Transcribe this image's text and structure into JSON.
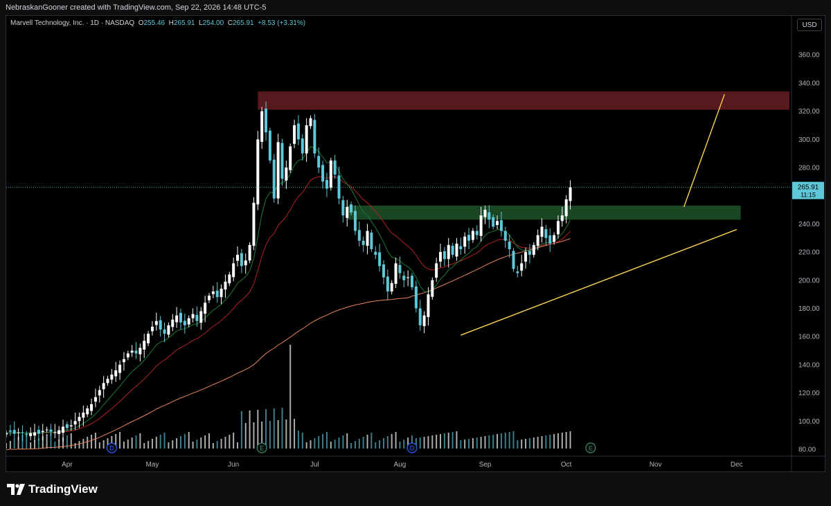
{
  "header": {
    "credit": "NebraskanGooner created with TradingView.com, Sep 22, 2026 14:48 UTC-5"
  },
  "legend": {
    "symbol": "Marvell Technology, Inc. · 1D · NASDAQ",
    "o_label": "O",
    "o": "255.46",
    "h_label": "H",
    "h": "265.91",
    "l_label": "L",
    "l": "254.00",
    "c_label": "C",
    "c": "265.91",
    "change": "+8.53 (+3.31%)"
  },
  "currency": "USD",
  "price_label": {
    "value": "265.91",
    "countdown": "11:15"
  },
  "brand": {
    "name": "TradingView"
  },
  "colors": {
    "up": "#ffffff",
    "down": "#5ec8d8",
    "ema_fast": "#1e7a32",
    "ema_mid": "#b22222",
    "sma_long": "#e8845a",
    "trendline": "#ffd54f",
    "resistance_zone": "#5c1a1f",
    "support_zone": "#1b4a25",
    "price_tag": "#5ec8d8"
  },
  "chart_data": {
    "type": "candlestick",
    "title": "Marvell Technology, Inc. · 1D · NASDAQ",
    "ylim": [
      75,
      375
    ],
    "yticks": [
      80,
      100,
      120,
      140,
      160,
      180,
      200,
      220,
      240,
      260,
      280,
      300,
      320,
      340,
      360
    ],
    "ytick_labels": [
      "80.00",
      "100.00",
      "120.00",
      "140.00",
      "160.00",
      "180.00",
      "200.00",
      "220.00",
      "240.00",
      "260.00",
      "280.00",
      "300.00",
      "320.00",
      "340.00",
      "360.00"
    ],
    "x_domain": [
      0,
      210
    ],
    "xticks": [
      {
        "label": "Apr",
        "x": 15
      },
      {
        "label": "May",
        "x": 36
      },
      {
        "label": "Jun",
        "x": 56
      },
      {
        "label": "Jul",
        "x": 76
      },
      {
        "label": "Aug",
        "x": 97
      },
      {
        "label": "Sep",
        "x": 118
      },
      {
        "label": "Oct",
        "x": 138
      },
      {
        "label": "Nov",
        "x": 160
      },
      {
        "label": "Dec",
        "x": 180
      }
    ],
    "closes": [
      91.5,
      92.5,
      91.0,
      92.0,
      91.5,
      90.5,
      91.5,
      92.0,
      91.0,
      93.0,
      94.0,
      92.5,
      92.0,
      93.5,
      96.0,
      95.0,
      97.0,
      100.0,
      103.0,
      106.0,
      109.0,
      112.0,
      117.0,
      122.0,
      127.0,
      130.0,
      133.0,
      136.0,
      140.0,
      144.0,
      148.0,
      150.0,
      148.0,
      152.0,
      157.0,
      162.0,
      167.0,
      171.0,
      165.0,
      162.0,
      168.0,
      172.0,
      175.0,
      170.0,
      168.0,
      173.0,
      176.0,
      171.0,
      178.0,
      184.0,
      189.0,
      192.0,
      188.0,
      194.0,
      199.0,
      204.0,
      212.0,
      218.0,
      210.0,
      214.0,
      225.0,
      255.0,
      300.0,
      320.0,
      305.0,
      285.0,
      258.0,
      298.0,
      272.0,
      280.0,
      295.0,
      310.0,
      300.0,
      290.0,
      310.0,
      315.0,
      290.0,
      280.0,
      270.0,
      265.0,
      285.0,
      275.0,
      258.0,
      246.0,
      252.0,
      248.0,
      235.0,
      228.0,
      225.0,
      235.0,
      222.0,
      218.0,
      210.0,
      202.0,
      192.0,
      198.0,
      212.0,
      205.0,
      200.0,
      202.0,
      195.0,
      180.0,
      168.0,
      175.0,
      190.0,
      200.0,
      212.0,
      220.0,
      215.0,
      225.0,
      218.0,
      226.0,
      222.0,
      231.0,
      228.0,
      235.0,
      232.0,
      246.0,
      250.0,
      243.0,
      238.0,
      242.0,
      235.0,
      228.0,
      222.0,
      208.0,
      205.0,
      212.0,
      220.0,
      218.0,
      225.0,
      232.0,
      238.0,
      230.0,
      226.0,
      232.0,
      242.0,
      246.0,
      257.4,
      265.91
    ],
    "series": [
      {
        "name": "",
        "type": "ema_fast"
      },
      {
        "name": "",
        "type": "ema_mid"
      },
      {
        "name": "",
        "type": "sma_long"
      }
    ],
    "zones": [
      {
        "type": "resistance",
        "x1": 62,
        "x2": 193,
        "y1": 321,
        "y2": 334
      },
      {
        "type": "support",
        "x1": 84,
        "x2": 181,
        "y1": 243,
        "y2": 253
      }
    ],
    "trendlines": [
      {
        "x1": 112,
        "y1": 161,
        "x2": 180,
        "y2": 236
      },
      {
        "x1": 167,
        "y1": 252,
        "x2": 177,
        "y2": 332
      }
    ],
    "event_markers": [
      {
        "label": "D",
        "x": 26
      },
      {
        "label": "E",
        "x": 63
      },
      {
        "label": "D",
        "x": 100
      },
      {
        "label": "E",
        "x": 144
      },
      {
        "label": "E",
        "x": 229,
        "future": true
      }
    ],
    "last_price": 265.91
  }
}
